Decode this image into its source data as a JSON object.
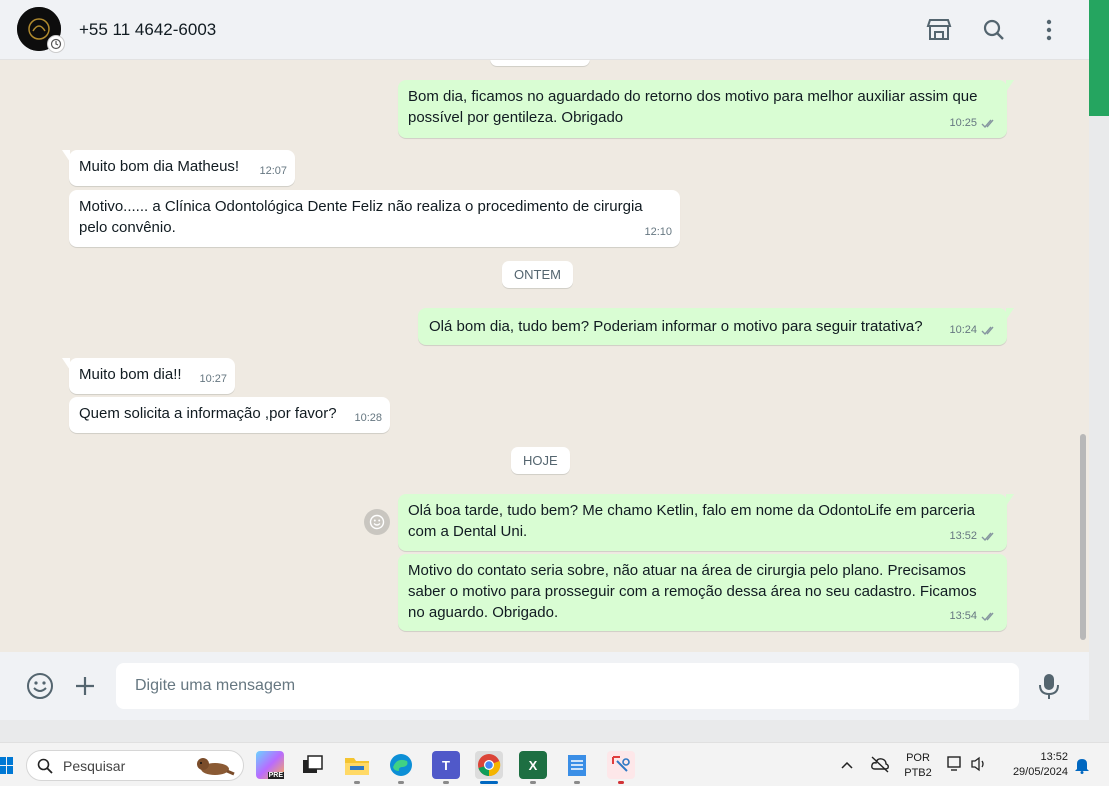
{
  "header": {
    "contact": "+55 11 4642-6003",
    "icons": [
      "store-icon",
      "search-icon",
      "menu-icon"
    ]
  },
  "messages": {
    "m1": {
      "text": "Bom dia, ficamos no aguardado do retorno dos motivo para melhor auxiliar assim que possível por gentileza. Obrigado",
      "time": "10:25"
    },
    "m2": {
      "text": "Muito bom dia Matheus!",
      "time": "12:07"
    },
    "m3": {
      "text": "Motivo...... a Clínica Odontológica Dente Feliz não realiza o procedimento de cirurgia pelo convênio.",
      "time": "12:10"
    },
    "day1": "ONTEM",
    "m4": {
      "text": "Olá bom dia, tudo bem? Poderiam informar o motivo para seguir tratativa?",
      "time": "10:24"
    },
    "m5": {
      "text": "Muito bom dia!!",
      "time": "10:27"
    },
    "m6": {
      "text": "Quem solicita a informação ,por favor?",
      "time": "10:28"
    },
    "day2": "HOJE",
    "m7": {
      "text": "Olá boa tarde, tudo bem? Me chamo Ketlin, falo em nome da OdontoLife em parceria com a Dental Uni.",
      "time": "13:52"
    },
    "m8": {
      "text": "Motivo do contato seria sobre, não atuar na área de cirurgia pelo plano. Precisamos saber o motivo para prosseguir com a remoção dessa área no seu cadastro. Ficamos no aguardo. Obrigado.",
      "time": "13:54"
    }
  },
  "composer": {
    "placeholder": "Digite uma mensagem"
  },
  "taskbar": {
    "search_label": "Pesquisar",
    "lang_top": "POR",
    "lang_bottom": "PTB2",
    "clock_time": "13:52",
    "clock_date": "29/05/2024"
  },
  "colors": {
    "outgoing": "#d9fdd3",
    "incoming": "#ffffff",
    "chat_bg": "#efeae2",
    "ticks": "#8696a0"
  }
}
